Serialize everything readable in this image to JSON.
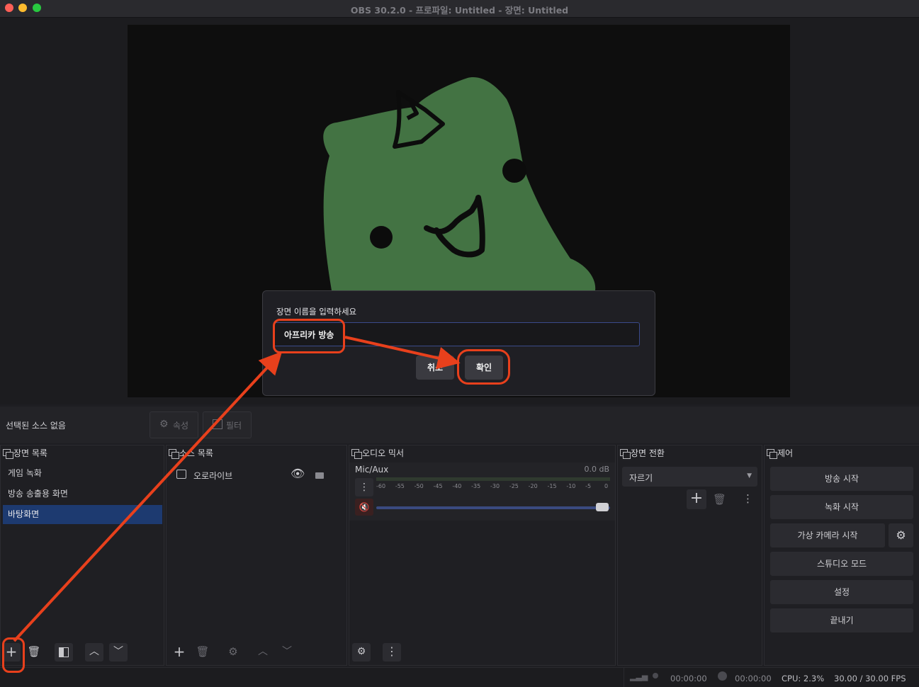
{
  "window": {
    "title": "OBS 30.2.0 - 프로파일: Untitled - 장면: Untitled",
    "traffic_colors": [
      "#fe5f57",
      "#febc2e",
      "#28c840"
    ]
  },
  "source_toolbar": {
    "no_source_text": "선택된 소스 없음",
    "properties_label": "속성",
    "filters_label": "필터"
  },
  "scenes": {
    "title": "장면 목록",
    "items": [
      "게임 녹화",
      "방송 송출용 화면",
      "바탕화면"
    ],
    "selected_index": 2
  },
  "sources": {
    "title": "소스 목록",
    "items": [
      {
        "name": "오로라이브"
      }
    ]
  },
  "mixer": {
    "title": "오디오 믹서",
    "channel": "Mic/Aux",
    "db": "0.0 dB",
    "ticks": [
      "-60",
      "-55",
      "-50",
      "-45",
      "-40",
      "-35",
      "-30",
      "-25",
      "-20",
      "-15",
      "-10",
      "-5",
      "0"
    ]
  },
  "transitions": {
    "title": "장면 전환",
    "selected": "자르기"
  },
  "controls": {
    "title": "제어",
    "buttons": [
      "방송 시작",
      "녹화 시작",
      "가상 카메라 시작",
      "스튜디오 모드",
      "설정",
      "끝내기"
    ]
  },
  "status": {
    "stream_time": "00:00:00",
    "record_time": "00:00:00",
    "cpu": "CPU: 2.3%",
    "fps": "30.00 / 30.00 FPS"
  },
  "dialog": {
    "label": "장면 이름을 입력하세요",
    "input_value": "아프리카 방송",
    "cancel_label": "취소",
    "ok_label": "확인"
  },
  "colors": {
    "accent": "#1d3a70",
    "annotation": "#e8401c",
    "mascot": "#437343"
  }
}
